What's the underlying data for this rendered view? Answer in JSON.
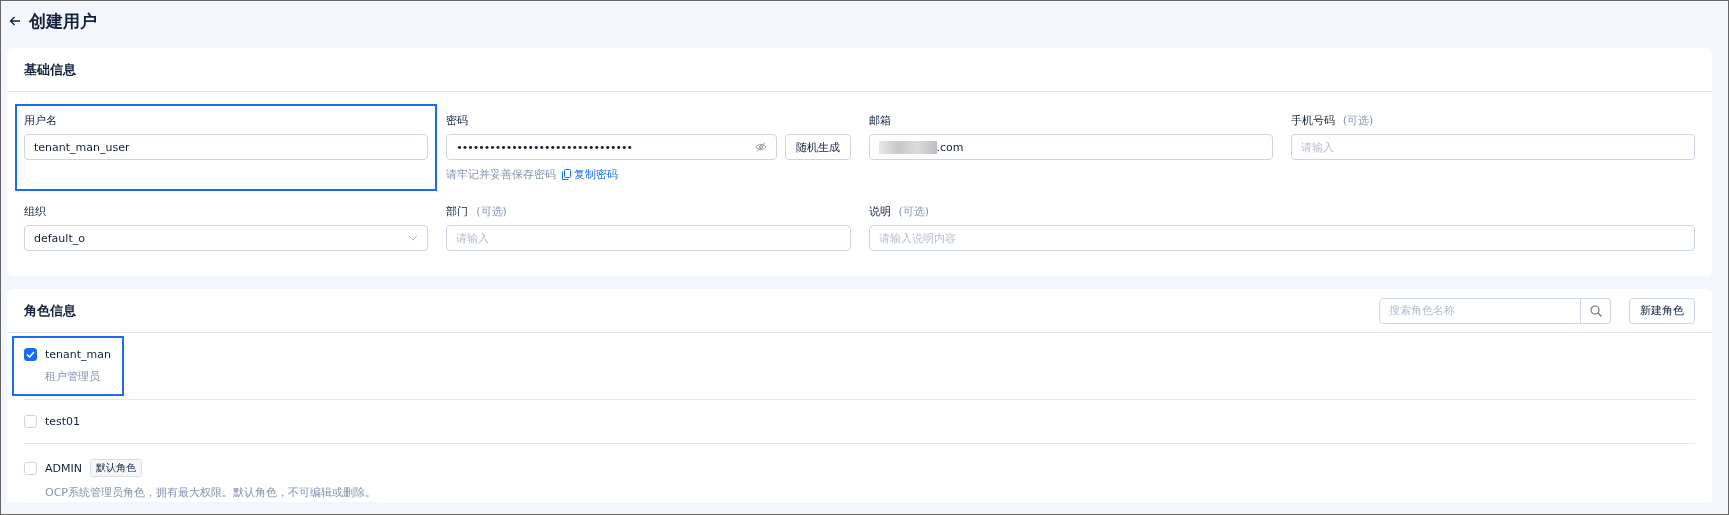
{
  "header": {
    "title": "创建用户"
  },
  "basic_info": {
    "title": "基础信息",
    "fields": [
      {
        "kind": "text",
        "label": "用户名",
        "value": "tenant_man_user",
        "highlighted": true
      },
      {
        "kind": "password",
        "label": "密码",
        "value": "••••••••••••••••••••••••••••••••",
        "button": "随机生成",
        "hint": "请牢记并妥善保存密码",
        "link": "复制密码"
      },
      {
        "kind": "redacted",
        "label": "邮箱",
        "value": ".com"
      },
      {
        "kind": "text",
        "label": "手机号码",
        "optional": "(可选)",
        "placeholder": "请输入"
      },
      {
        "kind": "select",
        "label": "组织",
        "value": "default_o"
      },
      {
        "kind": "text",
        "label": "部门",
        "optional": "(可选)",
        "placeholder": "请输入"
      },
      {
        "kind": "wide",
        "label": "说明",
        "optional": "(可选)",
        "placeholder": "请输入说明内容"
      }
    ]
  },
  "role_info": {
    "title": "角色信息",
    "search": {
      "placeholder": "搜索角色名称"
    },
    "new_button": "新建角色",
    "roles": [
      {
        "name": "tenant_man",
        "checked": true,
        "highlighted": true,
        "description": "租户管理员"
      },
      {
        "name": "test01",
        "checked": false,
        "highlighted": false
      },
      {
        "name": "ADMIN",
        "checked": false,
        "highlighted": false,
        "tag": "默认角色",
        "description": "OCP系统管理员角色，拥有最大权限。默认角色，不可编辑或删除。"
      }
    ]
  }
}
